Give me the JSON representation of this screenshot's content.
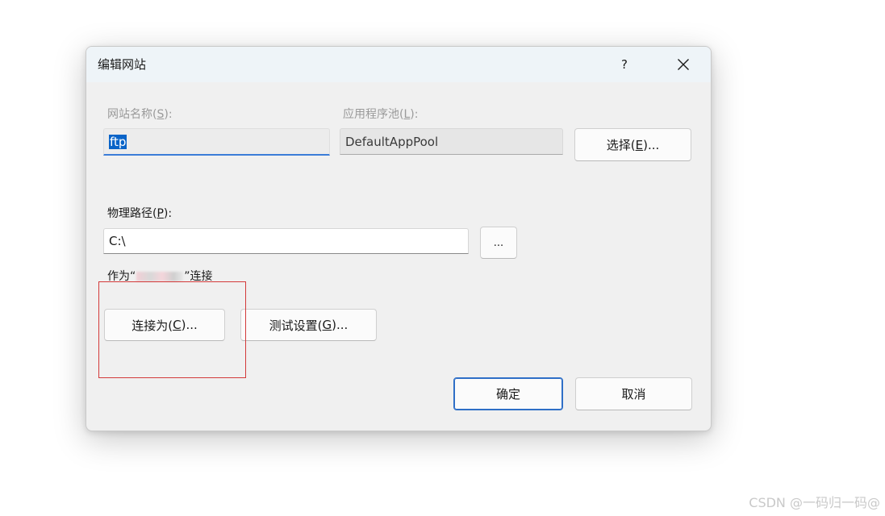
{
  "dialog": {
    "title": "编辑网站",
    "help_label": "?",
    "close_icon": "close-icon"
  },
  "site_name": {
    "label_prefix": "网站名称(",
    "label_key": "S",
    "label_suffix": "):",
    "value": "ftp"
  },
  "app_pool": {
    "label_prefix": "应用程序池(",
    "label_key": "L",
    "label_suffix": "):",
    "value": "DefaultAppPool",
    "select_prefix": "选择(",
    "select_key": "E",
    "select_suffix": ")..."
  },
  "physical_path": {
    "label_prefix": "物理路径(",
    "label_key": "P",
    "label_suffix": "):",
    "value": "C:\\",
    "browse_label": "..."
  },
  "connect_as": {
    "text_prefix": "作为“",
    "text_suffix": "”连接",
    "connect_prefix": "连接为(",
    "connect_key": "C",
    "connect_suffix": ")...",
    "test_prefix": "测试设置(",
    "test_key": "G",
    "test_suffix": ")..."
  },
  "footer": {
    "ok_label": "确定",
    "cancel_label": "取消"
  },
  "watermark": "CSDN @一码归一码@",
  "colors": {
    "highlight_box": "#d33a3a",
    "selection": "#0a64c8",
    "focus_underline": "#3b7dd8",
    "default_button_border": "#2f6fc7"
  }
}
